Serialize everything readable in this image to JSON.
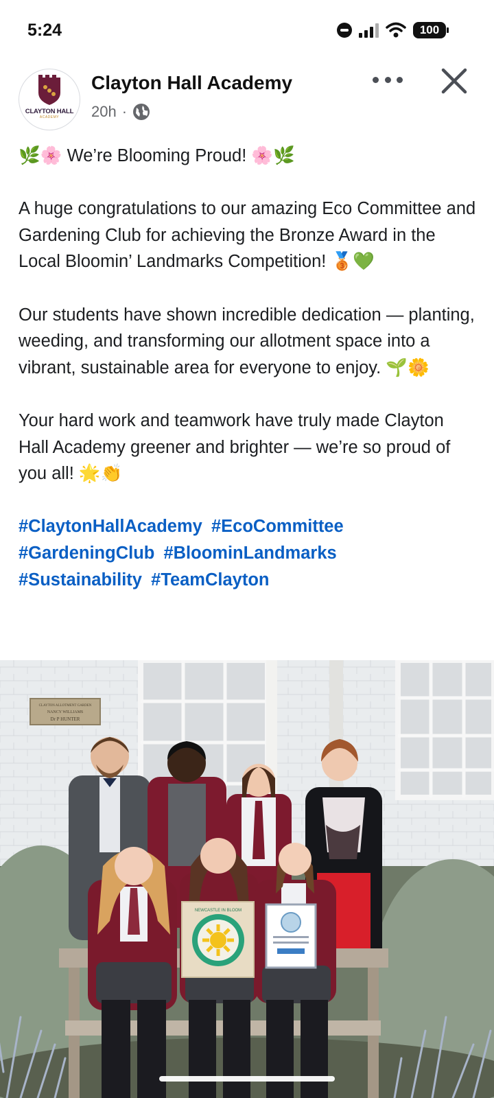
{
  "status_bar": {
    "time": "5:24",
    "battery": "100"
  },
  "post": {
    "page_name": "Clayton Hall Academy",
    "avatar_text": "CLAYTON HALL",
    "avatar_subtext": "ACADEMY",
    "time_ago": "20h",
    "separator": "·",
    "icons": {
      "audience": "globe-icon",
      "more": "more-dots-icon",
      "close": "close-icon"
    },
    "paragraphs": [
      {
        "text": "🌿🌸 We’re Blooming Proud! 🌸🌿"
      },
      {
        "text": "A huge congratulations to our amazing Eco Committee and Gardening Club for achieving the Bronze Award in the Local Bloomin’ Landmarks Competition! 🥉💚"
      },
      {
        "text": "Our students have shown incredible dedication — planting, weeding, and transforming our allotment space into a vibrant, sustainable area for everyone to enjoy. 🌱🌼"
      },
      {
        "text": "Your hard work and teamwork have truly made Clayton Hall Academy greener and brighter — we’re so proud of you all! 🌟👏"
      }
    ],
    "hashtags": [
      "#ClaytonHallAcademy",
      "#EcoCommittee",
      "#GardeningClub",
      "#BloominLandmarks",
      "#Sustainability",
      "#TeamClayton"
    ],
    "photo": {
      "plaque_lines": [
        "CLAYTON ALLOTMENT GARDEN",
        "NANCY WILLIAMS",
        "Dr P HUNTER"
      ],
      "bag_text": "NEWCASTLE IN BLOOM"
    }
  },
  "colors": {
    "hashtag": "#0a5fc4",
    "text": "#1c1e21",
    "meta": "#65676b",
    "crest": "#6b1d3a"
  }
}
